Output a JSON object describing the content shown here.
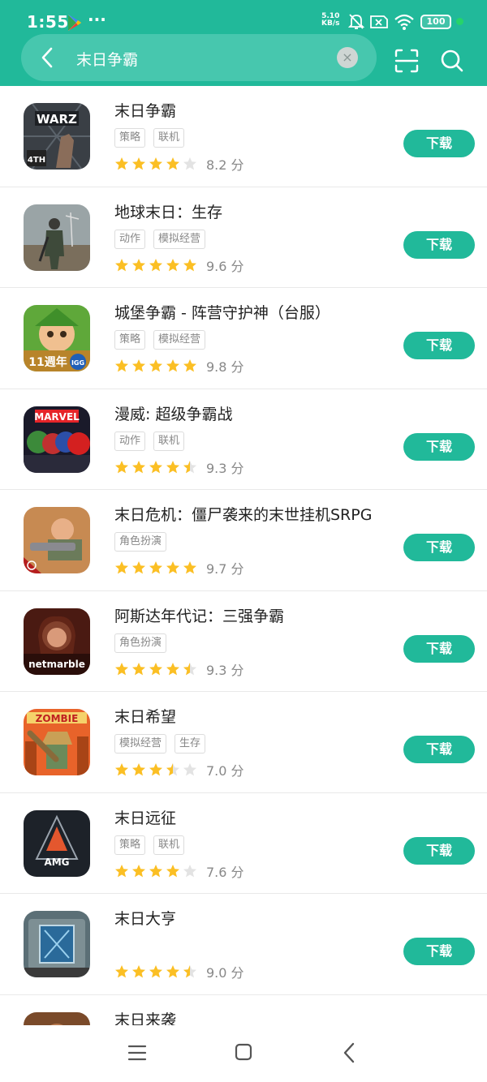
{
  "status": {
    "time": "1:55",
    "dots": "···",
    "netspeed_value": "5.10",
    "netspeed_unit": "KB/s",
    "battery": "100"
  },
  "search": {
    "query": "末日争霸",
    "clear_glyph": "×"
  },
  "colors": {
    "brand": "#21b99a",
    "star": "#fbbf24",
    "star_empty": "#e3e3e3"
  },
  "download_label": "下载",
  "score_unit": "分",
  "apps": [
    {
      "title": "末日争霸",
      "tags": [
        "策略",
        "联机"
      ],
      "rating": 4,
      "score": "8.2",
      "icon": "warz-app-icon"
    },
    {
      "title": "地球末日：生存",
      "tags": [
        "动作",
        "模拟经营"
      ],
      "rating": 5,
      "score": "9.6",
      "icon": "last-day-on-earth-app-icon"
    },
    {
      "title": "城堡争霸 - 阵营守护神（台服）",
      "tags": [
        "策略",
        "模拟经营"
      ],
      "rating": 5,
      "score": "9.8",
      "icon": "castle-clash-app-icon"
    },
    {
      "title": "漫威: 超级争霸战",
      "tags": [
        "动作",
        "联机"
      ],
      "rating": 4.5,
      "score": "9.3",
      "icon": "marvel-contest-app-icon"
    },
    {
      "title": "末日危机：僵尸袭来的末世挂机SRPG",
      "tags": [
        "角色扮演"
      ],
      "rating": 5,
      "score": "9.7",
      "icon": "doomsday-crisis-app-icon"
    },
    {
      "title": "阿斯达年代记：三强争霸",
      "tags": [
        "角色扮演"
      ],
      "rating": 4.5,
      "score": "9.3",
      "icon": "netmarble-app-icon"
    },
    {
      "title": "末日希望",
      "tags": [
        "模拟经营",
        "生存"
      ],
      "rating": 3.5,
      "score": "7.0",
      "icon": "zombie-app-icon"
    },
    {
      "title": "末日远征",
      "tags": [
        "策略",
        "联机"
      ],
      "rating": 4,
      "score": "7.6",
      "icon": "amg-app-icon"
    },
    {
      "title": "末日大亨",
      "tags": [],
      "rating": 4.5,
      "score": "9.0",
      "icon": "vault-door-app-icon"
    },
    {
      "title": "末日来袭",
      "tags": [],
      "rating": null,
      "score": "",
      "icon": "partial-app-icon"
    }
  ],
  "icons": {
    "play_store": "play-store-icon",
    "bell": "bell-muted-icon",
    "sim": "sim-x-icon",
    "wifi": "wifi-icon",
    "back": "back-chevron-icon",
    "scan": "scan-icon",
    "search": "search-icon",
    "nav_menu": "menu-icon",
    "nav_home": "home-icon",
    "nav_back": "nav-back-icon"
  }
}
